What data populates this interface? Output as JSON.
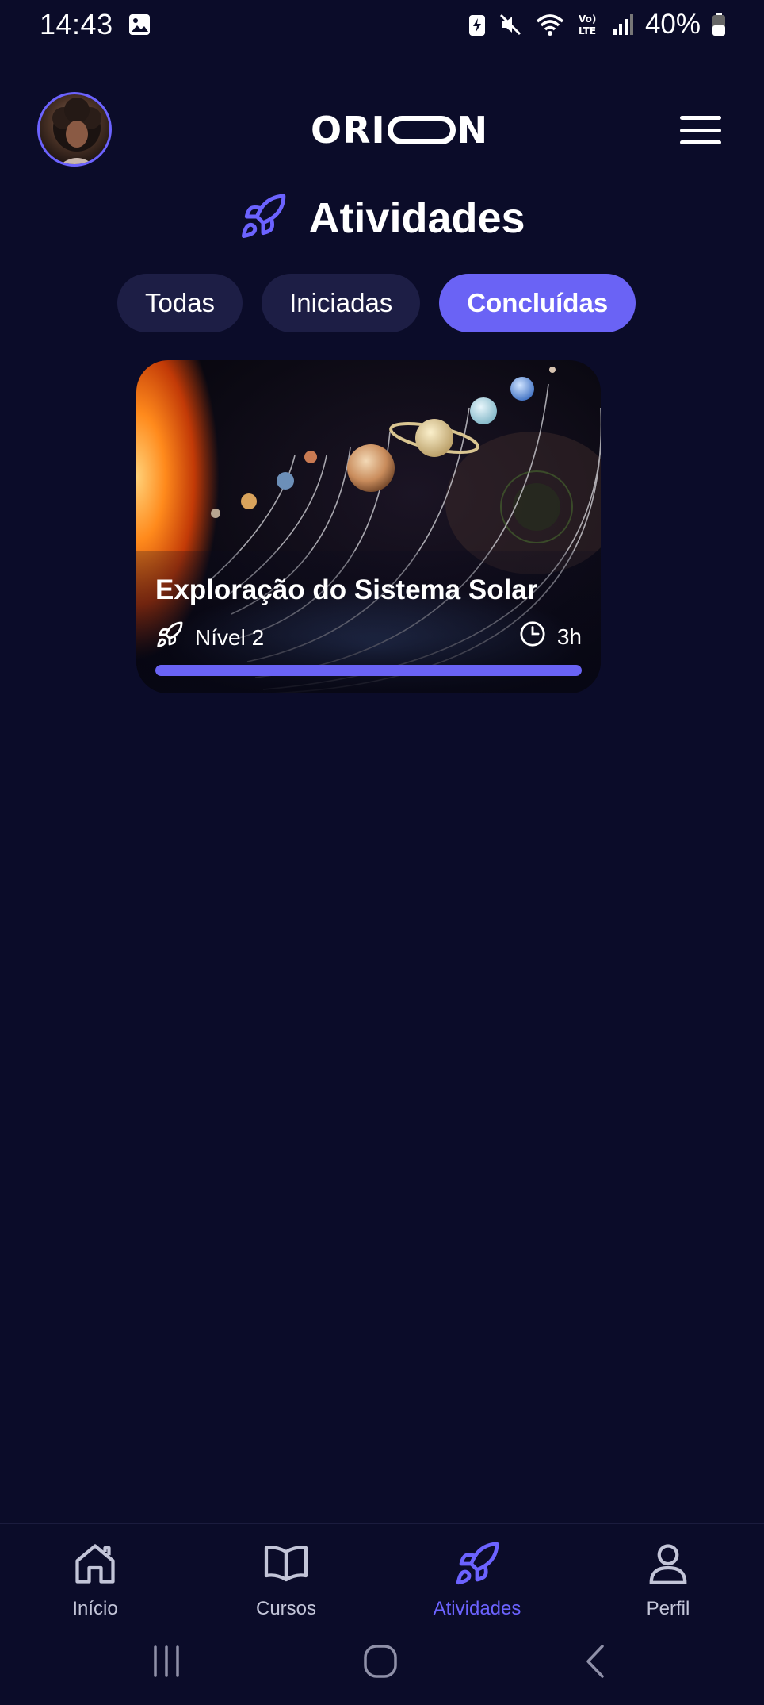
{
  "status_bar": {
    "time": "14:43",
    "battery_text": "40%",
    "icons": [
      "image-icon",
      "battery-saver-icon",
      "mute-icon",
      "wifi-icon",
      "volte-icon",
      "signal-icon",
      "battery-icon"
    ]
  },
  "header": {
    "logo_left": "ORI",
    "logo_right": "N",
    "menu_icon": "hamburger-menu-icon",
    "avatar_icon": "avatar"
  },
  "page": {
    "title": "Atividades",
    "title_icon": "rocket-icon"
  },
  "tabs": [
    {
      "label": "Todas",
      "active": false
    },
    {
      "label": "Iniciadas",
      "active": false
    },
    {
      "label": "Concluídas",
      "active": true
    }
  ],
  "activities": [
    {
      "title": "Exploração do Sistema Solar",
      "level": "Nível 2",
      "duration": "3h",
      "progress": 1.0
    }
  ],
  "bottom_nav": [
    {
      "label": "Início",
      "icon": "home-icon",
      "active": false
    },
    {
      "label": "Cursos",
      "icon": "book-icon",
      "active": false
    },
    {
      "label": "Atividades",
      "icon": "rocket-icon",
      "active": true
    },
    {
      "label": "Perfil",
      "icon": "user-icon",
      "active": false
    }
  ],
  "colors": {
    "background": "#0b0c29",
    "accent": "#6a63f5",
    "tab_inactive": "#1d1e45",
    "nav_inactive": "#c3c5d8"
  }
}
